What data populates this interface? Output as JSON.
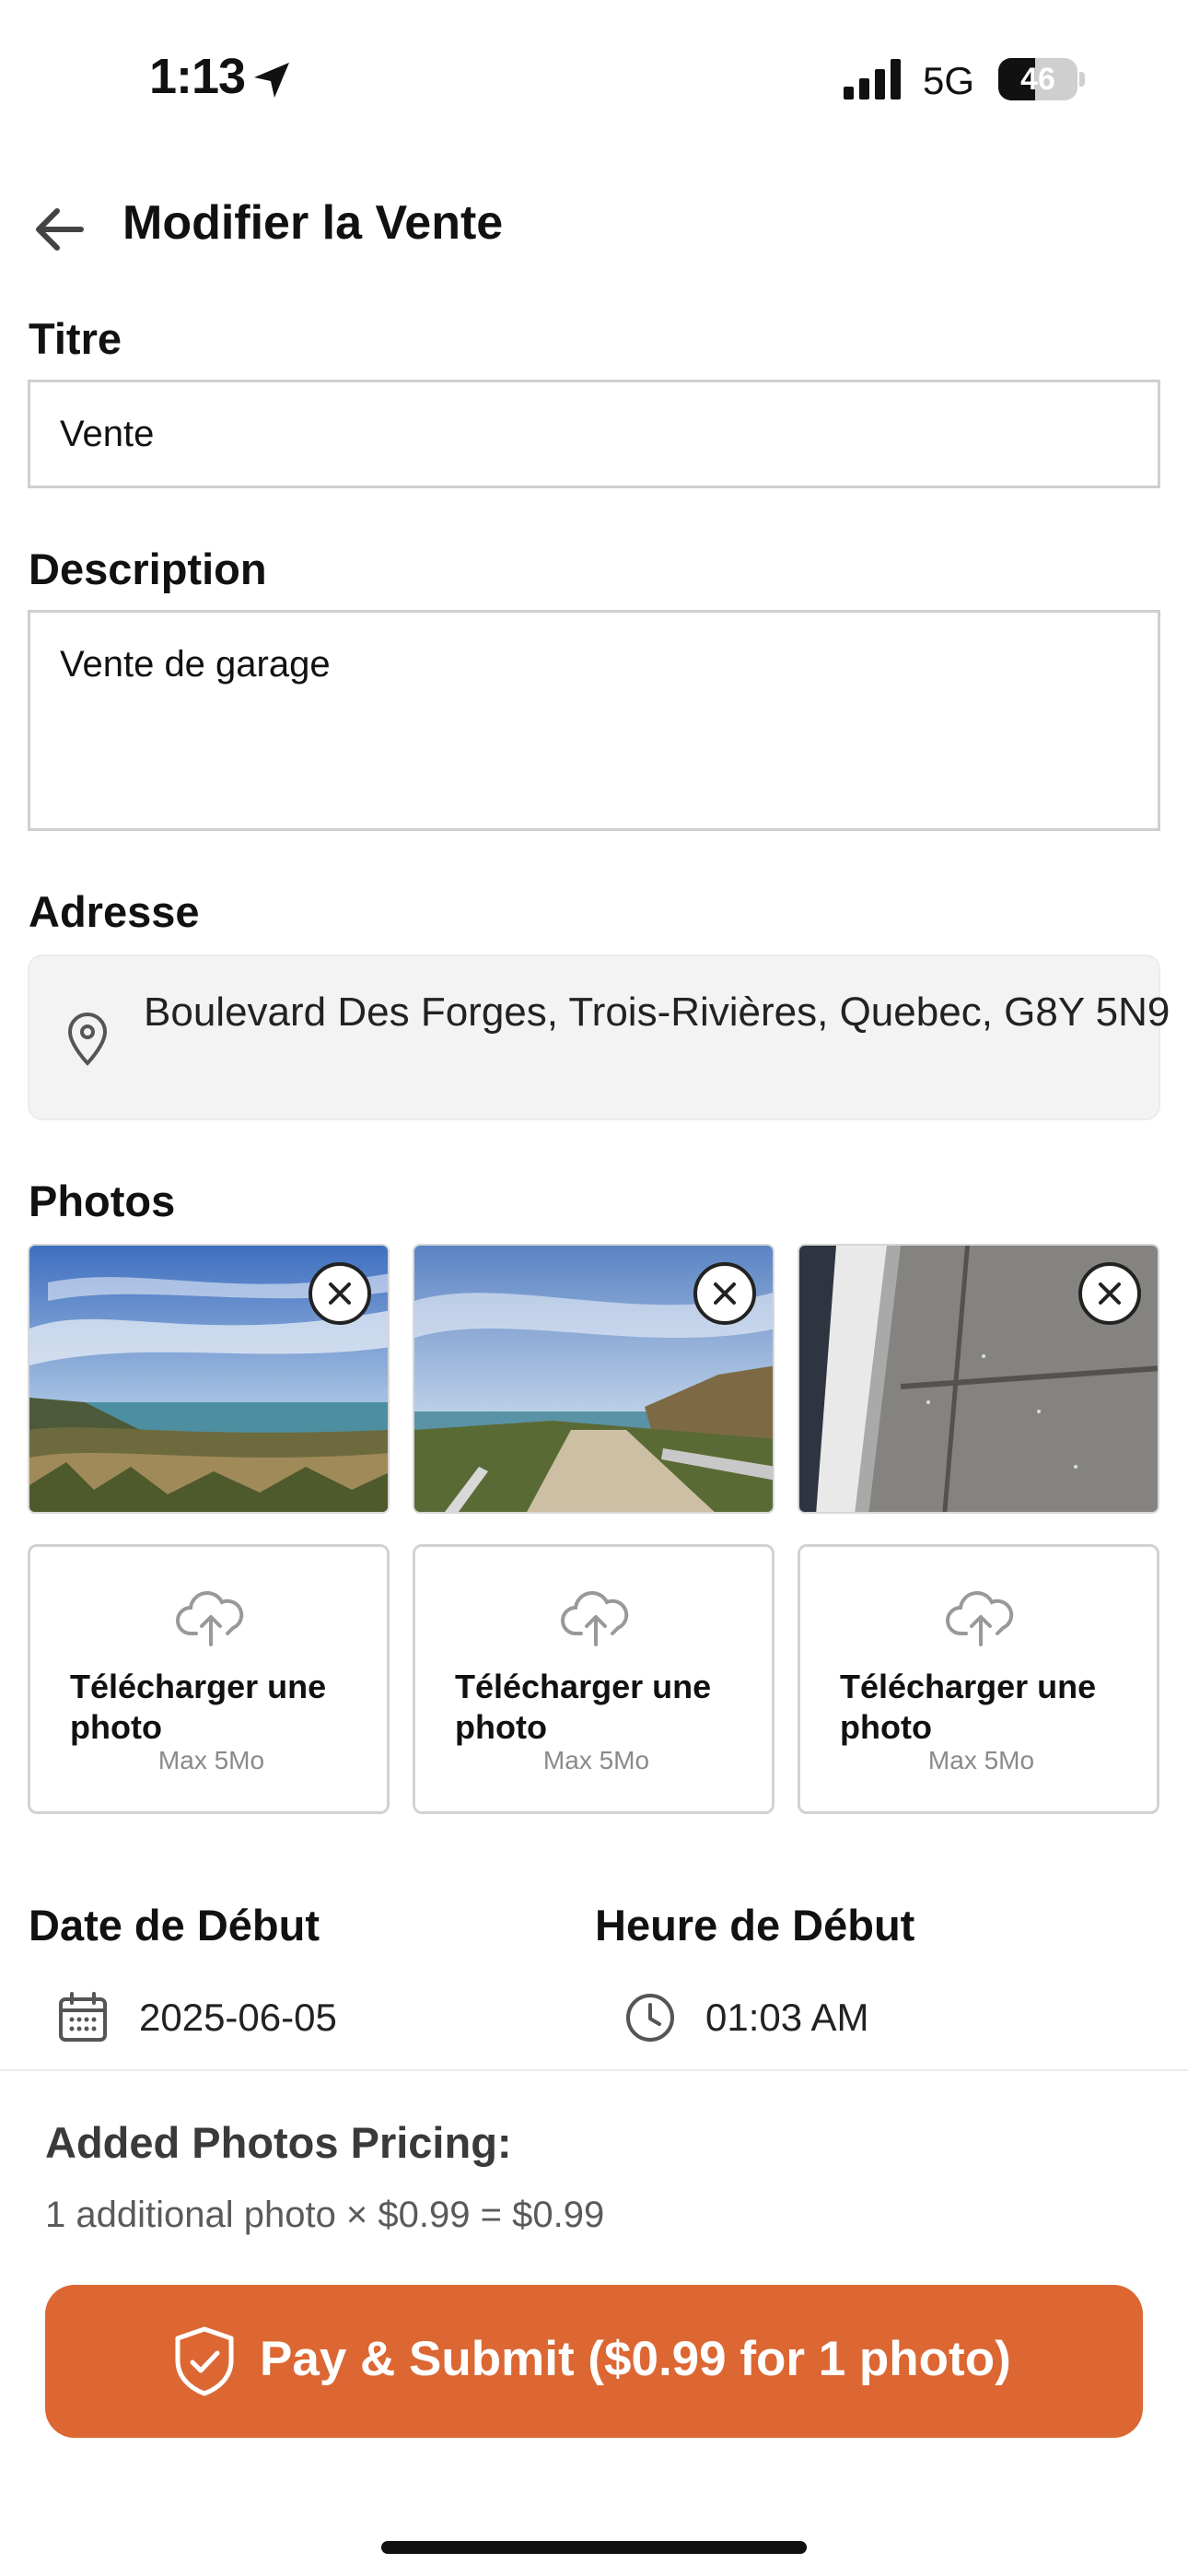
{
  "status_bar": {
    "time": "1:13",
    "network": "5G",
    "battery": "46",
    "battery_level": 0.46
  },
  "header": {
    "title": "Modifier la Vente"
  },
  "form": {
    "title_label": "Titre",
    "title_value": "Vente",
    "description_label": "Description",
    "description_value": "Vente de garage",
    "address_label": "Adresse",
    "address_value": "Boulevard Des Forges, Trois-Rivières, Quebec, G8Y 5N9",
    "photos_label": "Photos",
    "photos": [
      {
        "name": "coastal sky and ocean view"
      },
      {
        "name": "gravel path with guardrail by the sea"
      },
      {
        "name": "grey tiled surface close-up"
      }
    ],
    "uploads": [
      {
        "title": "Télécharger une photo",
        "subtitle": "Max 5Mo"
      },
      {
        "title": "Télécharger une photo",
        "subtitle": "Max 5Mo"
      },
      {
        "title": "Télécharger une photo",
        "subtitle": "Max 5Mo"
      }
    ],
    "start_date_label": "Date de Début",
    "start_date_value": "2025-06-05",
    "start_time_label": "Heure de Début",
    "start_time_value": "01:03 AM"
  },
  "pricing": {
    "title": "Added Photos Pricing:",
    "line": "1 additional photo × $0.99 = $0.99"
  },
  "submit": {
    "label": "Pay & Submit ($0.99 for 1 photo)"
  },
  "colors": {
    "accent": "#dc6733",
    "border": "#cfcfcf",
    "address_bg": "#f3f3f3"
  },
  "icons": [
    "location-arrow-icon",
    "signal-icon",
    "battery-icon",
    "back-arrow-icon",
    "map-pin-icon",
    "close-icon",
    "cloud-upload-icon",
    "calendar-icon",
    "clock-icon",
    "shield-check-icon"
  ]
}
